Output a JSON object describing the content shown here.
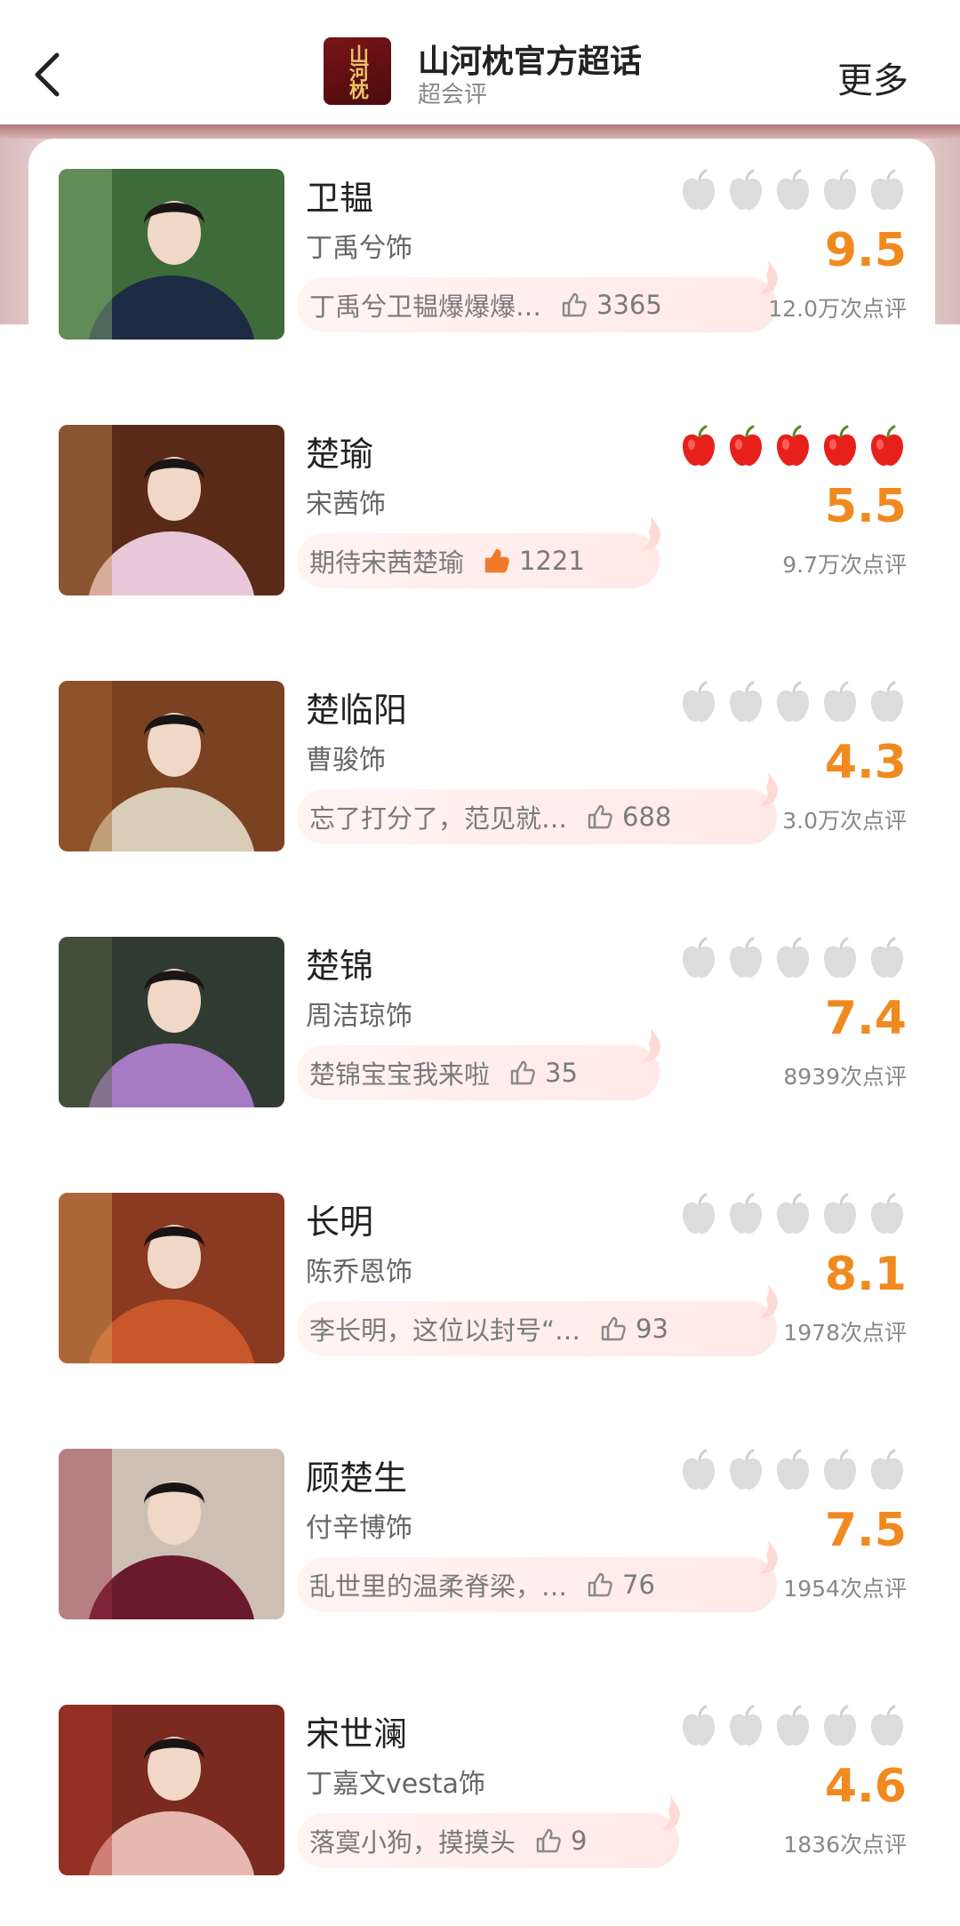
{
  "header": {
    "title": "山河枕官方超话",
    "subtitle": "超会评",
    "more_label": "更多",
    "logo_text": "山河枕"
  },
  "colors": {
    "score": "#f08a1e",
    "apple_gray": "#dcdcdc",
    "apple_red": "#e8201c"
  },
  "characters": [
    {
      "name": "卫韫",
      "actor": "丁禹兮饰",
      "comment": "丁禹兮卫韫爆爆爆…",
      "likes": "3365",
      "score": "9.5",
      "reviews": "12.0万次点评",
      "apples_filled": 0,
      "like_active": false
    },
    {
      "name": "楚瑜",
      "actor": "宋茜饰",
      "comment": "期待宋茜楚瑜",
      "likes": "1221",
      "score": "5.5",
      "reviews": "9.7万次点评",
      "apples_filled": 5,
      "like_active": true
    },
    {
      "name": "楚临阳",
      "actor": "曹骏饰",
      "comment": "忘了打分了，范见就…",
      "likes": "688",
      "score": "4.3",
      "reviews": "3.0万次点评",
      "apples_filled": 0,
      "like_active": false
    },
    {
      "name": "楚锦",
      "actor": "周洁琼饰",
      "comment": "楚锦宝宝我来啦",
      "likes": "35",
      "score": "7.4",
      "reviews": "8939次点评",
      "apples_filled": 0,
      "like_active": false
    },
    {
      "name": "长明",
      "actor": "陈乔恩饰",
      "comment": "李长明，这位以封号“…",
      "likes": "93",
      "score": "8.1",
      "reviews": "1978次点评",
      "apples_filled": 0,
      "like_active": false
    },
    {
      "name": "顾楚生",
      "actor": "付辛博饰",
      "comment": "乱世里的温柔脊梁，…",
      "likes": "76",
      "score": "7.5",
      "reviews": "1954次点评",
      "apples_filled": 0,
      "like_active": false
    },
    {
      "name": "宋世澜",
      "actor": "丁嘉文vesta饰",
      "comment": "落寞小狗，摸摸头",
      "likes": "9",
      "score": "4.6",
      "reviews": "1836次点评",
      "apples_filled": 0,
      "like_active": false
    }
  ]
}
